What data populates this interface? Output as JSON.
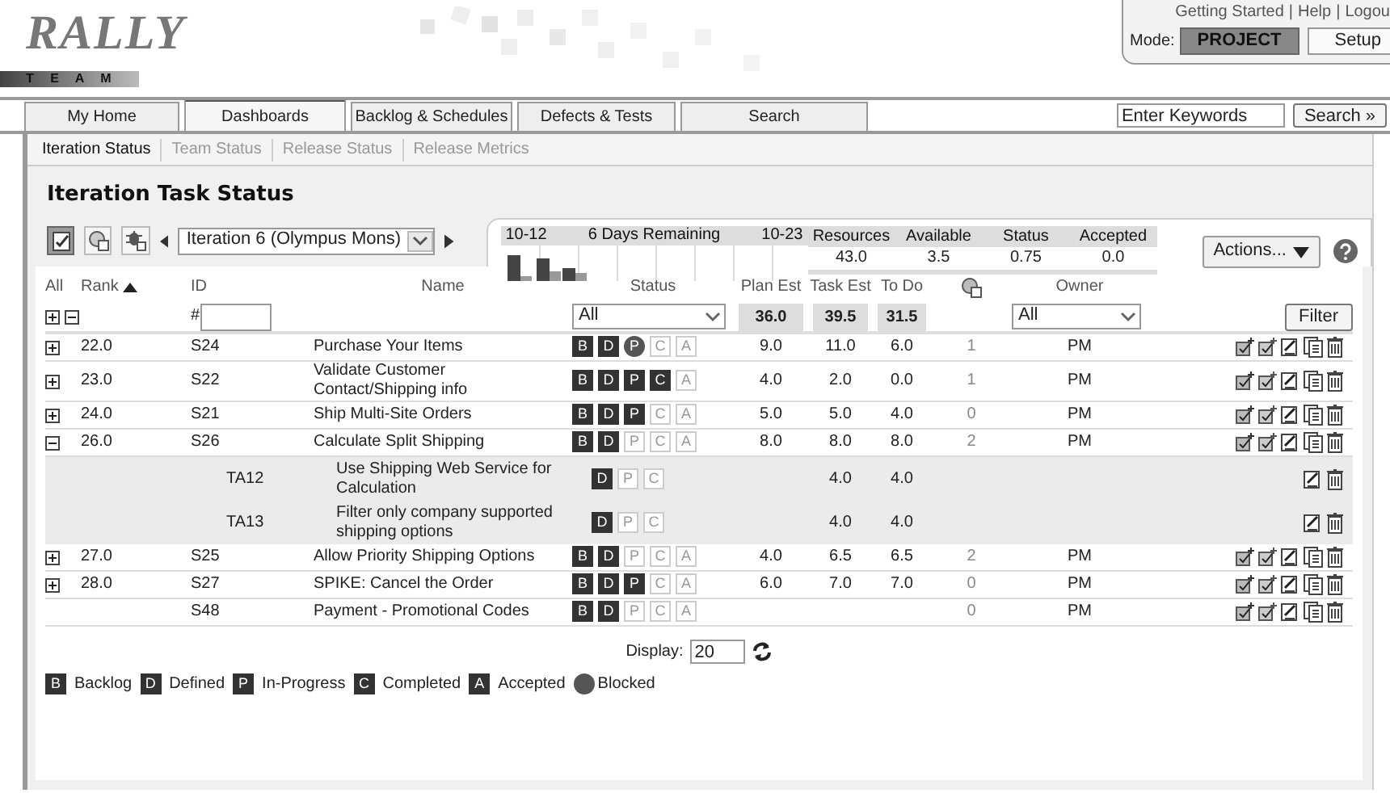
{
  "header": {
    "logo": {
      "name": "RALLY",
      "tagline": "T E A M"
    },
    "links": [
      {
        "label": "Getting Started"
      },
      {
        "label": "Help"
      },
      {
        "label": "Logou"
      }
    ],
    "separator": "|",
    "mode_label": "Mode:",
    "mode": "PROJECT",
    "setup": "Setup"
  },
  "tabs": [
    {
      "label": "My Home",
      "selected": false
    },
    {
      "label": "Dashboards",
      "selected": true
    },
    {
      "label": "Backlog & Schedules",
      "selected": false
    },
    {
      "label": "Defects & Tests",
      "selected": false
    },
    {
      "label": "Search",
      "selected": false
    }
  ],
  "search": {
    "value": "Enter Keywords",
    "button": "Search »"
  },
  "subtabs": [
    {
      "label": "Iteration Status",
      "selected": true
    },
    {
      "label": "Team Status",
      "selected": false
    },
    {
      "label": "Release Status",
      "selected": false
    },
    {
      "label": "Release Metrics",
      "selected": false
    }
  ],
  "page_title": "Iteration Task Status",
  "view_buttons": [
    {
      "kind": "tasks",
      "selected": true
    },
    {
      "kind": "discussions",
      "selected": false
    },
    {
      "kind": "defects",
      "selected": false
    }
  ],
  "iteration": {
    "value": "Iteration 6 (Olympus Mons)"
  },
  "summary": {
    "start": "10-12",
    "remaining": "6 Days Remaining",
    "end": "10-23",
    "stats": [
      {
        "label": "Resources",
        "value": "43.0"
      },
      {
        "label": "Available",
        "value": "3.5"
      },
      {
        "label": "Status",
        "value": "0.75"
      },
      {
        "label": "Accepted",
        "value": "0.0"
      }
    ]
  },
  "actions_button": "Actions...",
  "table": {
    "columns": {
      "all": "All",
      "rank": "Rank",
      "id": "ID",
      "name": "Name",
      "status": "Status",
      "plan_est": "Plan Est",
      "task_est": "Task Est",
      "to_do": "To Do",
      "owner": "Owner"
    },
    "filters": {
      "id_prefix": "#",
      "status": "All",
      "owner": "All",
      "totals": [
        "36.0",
        "39.5",
        "31.5"
      ],
      "button": "Filter"
    },
    "rows": [
      {
        "kind": "story",
        "expanded": false,
        "rank": "22.0",
        "id": "S24",
        "name": "Purchase Your Items",
        "states": [
          {
            "letter": "B",
            "kind": "on"
          },
          {
            "letter": "D",
            "kind": "on"
          },
          {
            "letter": "P",
            "kind": "blocked"
          },
          {
            "letter": "C",
            "kind": "off"
          },
          {
            "letter": "A",
            "kind": "off"
          }
        ],
        "plan_est": "9.0",
        "task_est": "11.0",
        "to_do": "6.0",
        "discussions": "1",
        "owner": "PM"
      },
      {
        "kind": "story",
        "expanded": false,
        "rank": "23.0",
        "id": "S22",
        "name": "Validate Customer Contact/Shipping info",
        "states": [
          {
            "letter": "B",
            "kind": "on"
          },
          {
            "letter": "D",
            "kind": "on"
          },
          {
            "letter": "P",
            "kind": "on"
          },
          {
            "letter": "C",
            "kind": "on"
          },
          {
            "letter": "A",
            "kind": "off"
          }
        ],
        "plan_est": "4.0",
        "task_est": "2.0",
        "to_do": "0.0",
        "discussions": "1",
        "owner": "PM"
      },
      {
        "kind": "story",
        "expanded": false,
        "rank": "24.0",
        "id": "S21",
        "name": "Ship Multi-Site Orders",
        "states": [
          {
            "letter": "B",
            "kind": "on"
          },
          {
            "letter": "D",
            "kind": "on"
          },
          {
            "letter": "P",
            "kind": "on"
          },
          {
            "letter": "C",
            "kind": "off"
          },
          {
            "letter": "A",
            "kind": "off"
          }
        ],
        "plan_est": "5.0",
        "task_est": "5.0",
        "to_do": "4.0",
        "discussions": "0",
        "owner": "PM"
      },
      {
        "kind": "story",
        "expanded": true,
        "rank": "26.0",
        "id": "S26",
        "name": "Calculate Split Shipping",
        "states": [
          {
            "letter": "B",
            "kind": "on"
          },
          {
            "letter": "D",
            "kind": "on"
          },
          {
            "letter": "P",
            "kind": "off"
          },
          {
            "letter": "C",
            "kind": "off"
          },
          {
            "letter": "A",
            "kind": "off"
          }
        ],
        "plan_est": "8.0",
        "task_est": "8.0",
        "to_do": "8.0",
        "discussions": "2",
        "owner": "PM"
      },
      {
        "kind": "task",
        "id": "TA12",
        "name": "Use Shipping Web Service for Calculation",
        "states": [
          {
            "letter": "D",
            "kind": "on"
          },
          {
            "letter": "P",
            "kind": "off"
          },
          {
            "letter": "C",
            "kind": "off"
          }
        ],
        "task_est": "4.0",
        "to_do": "4.0"
      },
      {
        "kind": "task",
        "id": "TA13",
        "name": "Filter only company supported shipping options",
        "states": [
          {
            "letter": "D",
            "kind": "on"
          },
          {
            "letter": "P",
            "kind": "off"
          },
          {
            "letter": "C",
            "kind": "off"
          }
        ],
        "task_est": "4.0",
        "to_do": "4.0"
      },
      {
        "kind": "story",
        "expanded": false,
        "rank": "27.0",
        "id": "S25",
        "name": "Allow Priority Shipping Options",
        "states": [
          {
            "letter": "B",
            "kind": "on"
          },
          {
            "letter": "D",
            "kind": "on"
          },
          {
            "letter": "P",
            "kind": "off"
          },
          {
            "letter": "C",
            "kind": "off"
          },
          {
            "letter": "A",
            "kind": "off"
          }
        ],
        "plan_est": "4.0",
        "task_est": "6.5",
        "to_do": "6.5",
        "discussions": "2",
        "owner": "PM"
      },
      {
        "kind": "story",
        "expanded": false,
        "rank": "28.0",
        "id": "S27",
        "name": "SPIKE: Cancel the Order",
        "states": [
          {
            "letter": "B",
            "kind": "on"
          },
          {
            "letter": "D",
            "kind": "on"
          },
          {
            "letter": "P",
            "kind": "on"
          },
          {
            "letter": "C",
            "kind": "off"
          },
          {
            "letter": "A",
            "kind": "off"
          }
        ],
        "plan_est": "6.0",
        "task_est": "7.0",
        "to_do": "7.0",
        "discussions": "0",
        "owner": "PM"
      },
      {
        "kind": "story",
        "id": "S48",
        "name": "Payment - Promotional Codes",
        "states": [
          {
            "letter": "B",
            "kind": "on"
          },
          {
            "letter": "D",
            "kind": "on"
          },
          {
            "letter": "P",
            "kind": "off"
          },
          {
            "letter": "C",
            "kind": "off"
          },
          {
            "letter": "A",
            "kind": "off"
          }
        ],
        "discussions": "0",
        "owner": "PM"
      }
    ]
  },
  "display": {
    "label": "Display:",
    "value": "20"
  },
  "legend": [
    {
      "kind": "box",
      "letter": "B",
      "label": "Backlog"
    },
    {
      "kind": "box",
      "letter": "D",
      "label": "Defined"
    },
    {
      "kind": "box",
      "letter": "P",
      "label": "In-Progress"
    },
    {
      "kind": "box",
      "letter": "C",
      "label": "Completed"
    },
    {
      "kind": "box",
      "letter": "A",
      "label": "Accepted"
    },
    {
      "kind": "circle",
      "label": "Blocked"
    }
  ]
}
